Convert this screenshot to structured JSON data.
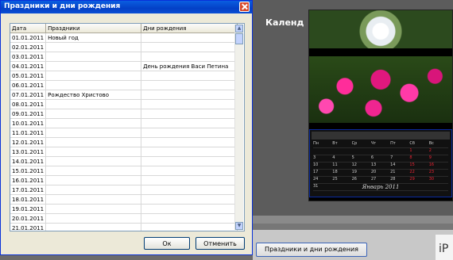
{
  "dialog": {
    "title": "Праздники и дни рождения",
    "columns": [
      "Дата",
      "Праздники",
      "Дни рождения"
    ],
    "rows": [
      [
        "01.01.2011",
        "Новый год",
        ""
      ],
      [
        "02.01.2011",
        "",
        ""
      ],
      [
        "03.01.2011",
        "",
        ""
      ],
      [
        "04.01.2011",
        "",
        "День рождения Васи Петина"
      ],
      [
        "05.01.2011",
        "",
        ""
      ],
      [
        "06.01.2011",
        "",
        ""
      ],
      [
        "07.01.2011",
        "Рождество Христово",
        ""
      ],
      [
        "08.01.2011",
        "",
        ""
      ],
      [
        "09.01.2011",
        "",
        ""
      ],
      [
        "10.01.2011",
        "",
        ""
      ],
      [
        "11.01.2011",
        "",
        ""
      ],
      [
        "12.01.2011",
        "",
        ""
      ],
      [
        "13.01.2011",
        "",
        ""
      ],
      [
        "14.01.2011",
        "",
        ""
      ],
      [
        "15.01.2011",
        "",
        ""
      ],
      [
        "16.01.2011",
        "",
        ""
      ],
      [
        "17.01.2011",
        "",
        ""
      ],
      [
        "18.01.2011",
        "",
        ""
      ],
      [
        "19.01.2011",
        "",
        ""
      ],
      [
        "20.01.2011",
        "",
        ""
      ],
      [
        "21.01.2011",
        "",
        ""
      ]
    ],
    "ok_label": "Ок",
    "cancel_label": "Отменить"
  },
  "background": {
    "title": "Календ",
    "month_label": "Январь 2011",
    "button_label": "Праздники и дни рождения",
    "corner_text": "iP",
    "weekdays": [
      "Пн",
      "Вт",
      "Ср",
      "Чт",
      "Пт",
      "Сб",
      "Вс"
    ],
    "calendar_rows": [
      [
        "",
        "",
        "",
        "",
        "",
        "1",
        "2"
      ],
      [
        "3",
        "4",
        "5",
        "6",
        "7",
        "8",
        "9"
      ],
      [
        "10",
        "11",
        "12",
        "13",
        "14",
        "15",
        "16"
      ],
      [
        "17",
        "18",
        "19",
        "20",
        "21",
        "22",
        "23"
      ],
      [
        "24",
        "25",
        "26",
        "27",
        "28",
        "29",
        "30"
      ],
      [
        "31",
        "",
        "",
        "",
        "",
        "",
        ""
      ]
    ]
  }
}
